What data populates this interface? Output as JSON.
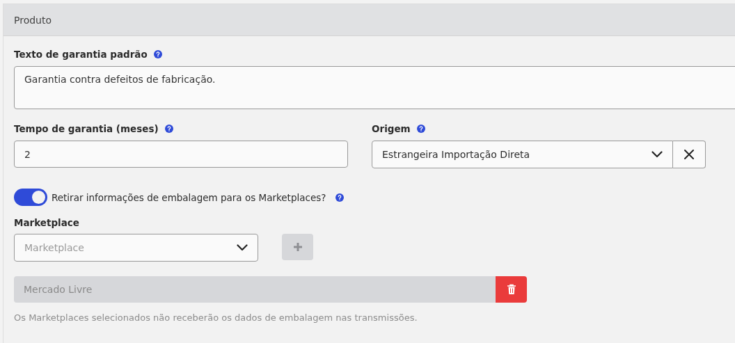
{
  "panel": {
    "title": "Produto"
  },
  "warranty_text": {
    "label": "Texto de garantia padrão",
    "value": "Garantia contra defeitos de fabricação."
  },
  "warranty_time": {
    "label": "Tempo de garantia (meses)",
    "value": "2"
  },
  "origin": {
    "label": "Origem",
    "value": "Estrangeira Importação Direta"
  },
  "packaging_toggle": {
    "label": "Retirar informações de embalagem para os Marketplaces?",
    "on": true
  },
  "marketplace": {
    "label": "Marketplace",
    "placeholder": "Marketplace",
    "add_disabled": true
  },
  "selected_marketplaces": [
    {
      "name": "Mercado Livre"
    }
  ],
  "help_text": "Os Marketplaces selecionados não receberão os dados de embalagem nas transmissões."
}
